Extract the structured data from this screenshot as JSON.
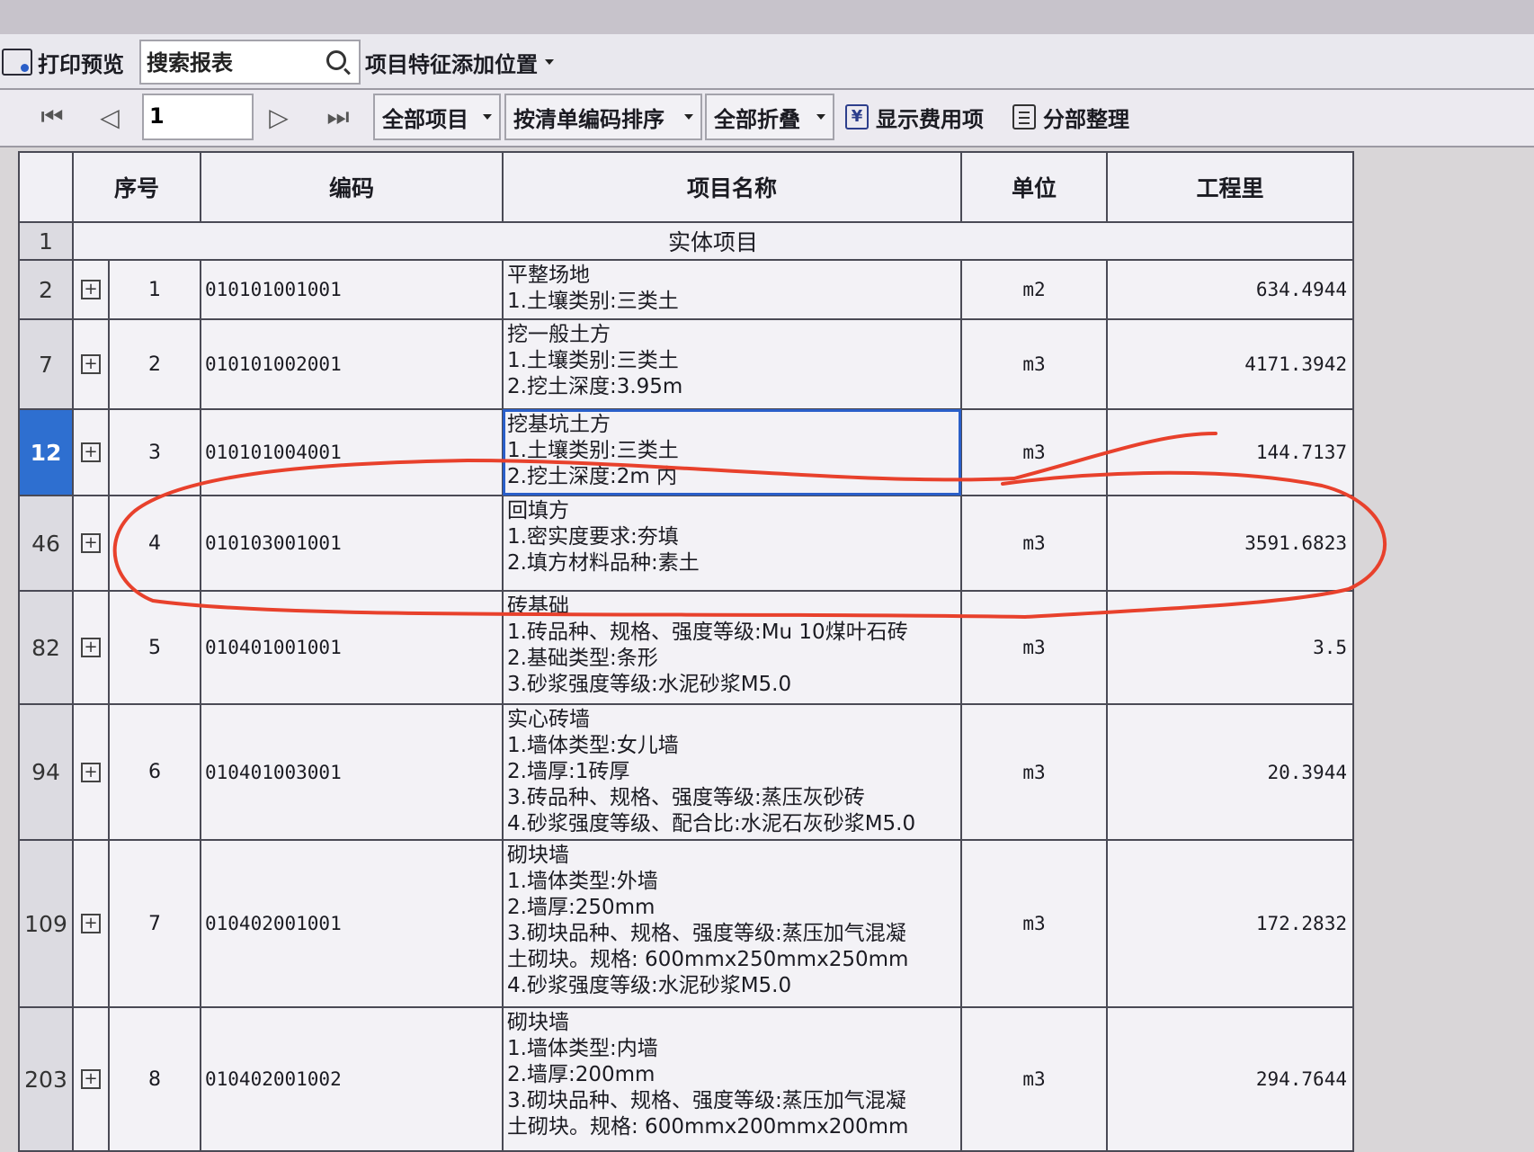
{
  "toolbar": {
    "print_preview_label": "打印预览",
    "search_placeholder": "搜索报表",
    "feature_position_label": "项目特征添加位置"
  },
  "nav": {
    "page_value": "1",
    "filter_label": "全部项目",
    "sort_label": "按清单编码排序",
    "collapse_label": "全部折叠",
    "show_fee_label": "显示费用项",
    "section_tidy_label": "分部整理"
  },
  "table": {
    "headers": {
      "seq": "序号",
      "code": "编码",
      "name": "项目名称",
      "unit": "单位",
      "qty": "工程里"
    },
    "group": {
      "row": "1",
      "title": "实体项目"
    },
    "rows": [
      {
        "row": "2",
        "seq": "1",
        "code": "010101001001",
        "name": [
          "平整场地",
          "1.土壤类别:三类土"
        ],
        "unit": "m2",
        "qty": "634.4944"
      },
      {
        "row": "7",
        "seq": "2",
        "code": "010101002001",
        "name": [
          "挖一般土方",
          "1.土壤类别:三类土",
          "2.挖土深度:3.95m"
        ],
        "unit": "m3",
        "qty": "4171.3942"
      },
      {
        "row": "12",
        "seq": "3",
        "code": "010101004001",
        "name": [
          "挖基坑土方",
          "1.土壤类别:三类土",
          "2.挖土深度:2m 内"
        ],
        "unit": "m3",
        "qty": "144.7137"
      },
      {
        "row": "46",
        "seq": "4",
        "code": "010103001001",
        "name": [
          "回填方",
          "1.密实度要求:夯填",
          "2.填方材料品种:素土"
        ],
        "unit": "m3",
        "qty": "3591.6823"
      },
      {
        "row": "82",
        "seq": "5",
        "code": "010401001001",
        "name": [
          "砖基础",
          "1.砖品种、规格、强度等级:Mu 10煤叶石砖",
          "2.基础类型:条形",
          "3.砂浆强度等级:水泥砂浆M5.0"
        ],
        "unit": "m3",
        "qty": "3.5"
      },
      {
        "row": "94",
        "seq": "6",
        "code": "010401003001",
        "name": [
          "实心砖墙",
          "1.墙体类型:女儿墙",
          "2.墙厚:1砖厚",
          "3.砖品种、规格、强度等级:蒸压灰砂砖",
          "4.砂浆强度等级、配合比:水泥石灰砂浆M5.0"
        ],
        "unit": "m3",
        "qty": "20.3944"
      },
      {
        "row": "109",
        "seq": "7",
        "code": "010402001001",
        "name": [
          "砌块墙",
          "1.墙体类型:外墙",
          "2.墙厚:250mm",
          "3.砌块品种、规格、强度等级:蒸压加气混凝",
          "土砌块。规格: 600mmx250mmx250mm",
          "4.砂浆强度等级:水泥砂浆M5.0"
        ],
        "unit": "m3",
        "qty": "172.2832"
      },
      {
        "row": "203",
        "seq": "8",
        "code": "010402001002",
        "name": [
          "砌块墙",
          "1.墙体类型:内墙",
          "2.墙厚:200mm",
          "3.砌块品种、规格、强度等级:蒸压加气混凝",
          "土砌块。规格: 600mmx200mmx200mm"
        ],
        "unit": "m3",
        "qty": "294.7644"
      }
    ]
  },
  "colors": {
    "selection": "#2e6fd0",
    "annotation": "#e8412c"
  }
}
